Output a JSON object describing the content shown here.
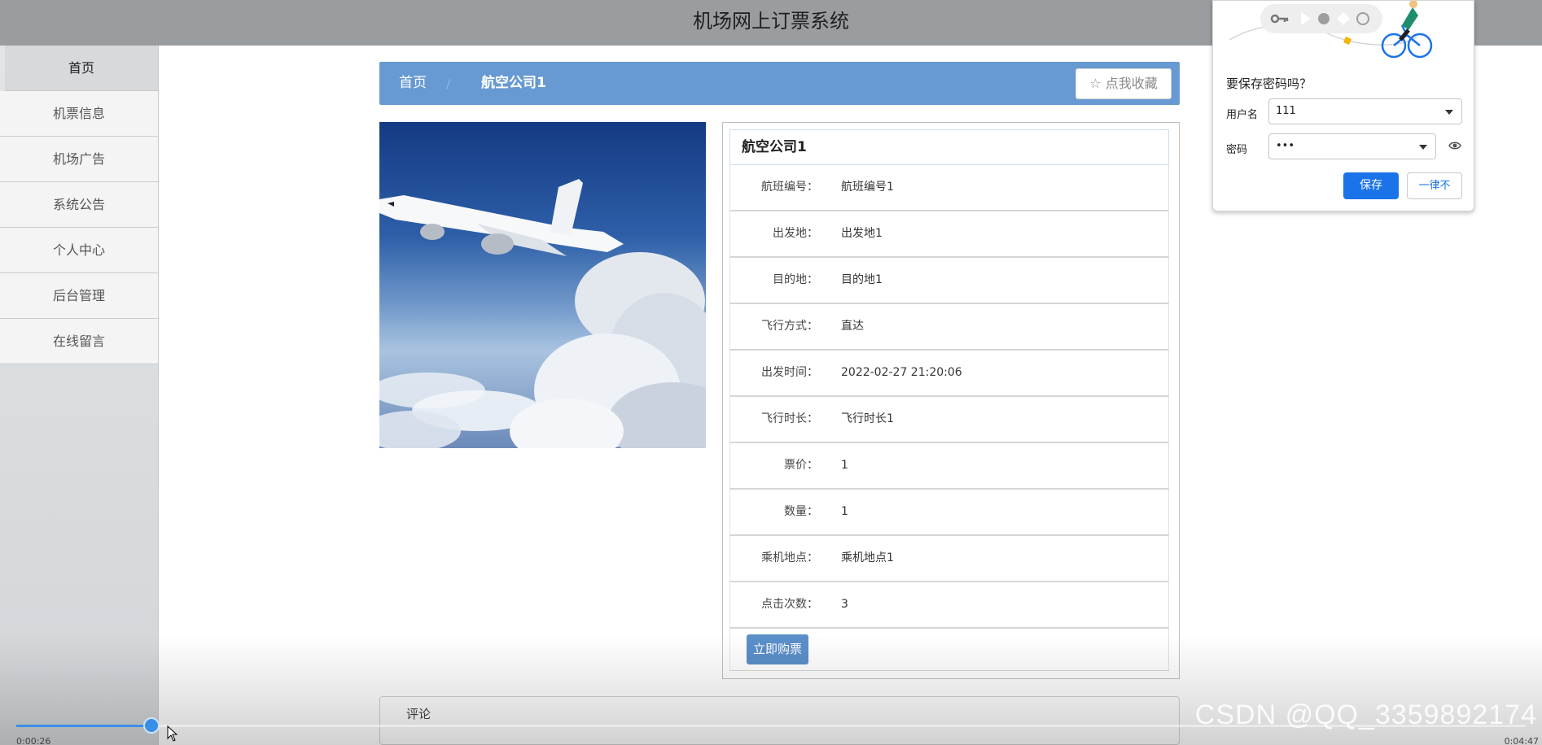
{
  "header": {
    "title": "机场网上订票系统"
  },
  "sidebar": {
    "items": [
      {
        "label": "首页",
        "active": true
      },
      {
        "label": "机票信息"
      },
      {
        "label": "机场广告"
      },
      {
        "label": "系统公告"
      },
      {
        "label": "个人中心"
      },
      {
        "label": "后台管理"
      },
      {
        "label": "在线留言"
      }
    ]
  },
  "breadcrumb": {
    "home": "首页",
    "separator": "/",
    "current": "航空公司1",
    "favorite_label": "☆ 点我收藏"
  },
  "detail": {
    "title": "航空公司1",
    "rows": [
      {
        "label": "航班编号：",
        "value": "航班编号1"
      },
      {
        "label": "出发地：",
        "value": "出发地1"
      },
      {
        "label": "目的地：",
        "value": "目的地1"
      },
      {
        "label": "飞行方式：",
        "value": "直达"
      },
      {
        "label": "出发时间：",
        "value": "2022-02-27 21:20:06"
      },
      {
        "label": "飞行时长：",
        "value": "飞行时长1"
      },
      {
        "label": "票价：",
        "value": "1"
      },
      {
        "label": "数量：",
        "value": "1"
      },
      {
        "label": "乘机地点：",
        "value": "乘机地点1"
      },
      {
        "label": "点击次数：",
        "value": "3"
      }
    ],
    "buy_label": "立即购票"
  },
  "comment": {
    "label": "评论"
  },
  "video": {
    "elapsed": "0:00:26",
    "duration": "0:04:47",
    "progress_percent": 9.1
  },
  "watermark": "CSDN @QQ_3359892174",
  "password_prompt": {
    "question": "要保存密码吗？",
    "username_label": "用户名",
    "username_value": "111",
    "password_label": "密码",
    "password_value": "•••",
    "save_label": "保存",
    "never_label": "一律不"
  },
  "colors": {
    "breadcrumb_bg": "#6799d2",
    "buy_button": "#5b8fc9",
    "save_button": "#1a73e8",
    "progress": "#3a8ee6"
  }
}
